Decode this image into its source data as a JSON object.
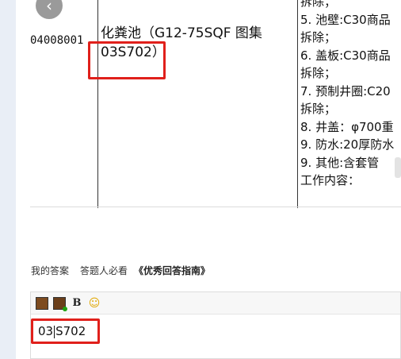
{
  "document": {
    "code": "04008001",
    "name_lines": [
      "化粪池（G12-75SQF 图集",
      "03S702）"
    ],
    "desc_lines": [
      "拆除；",
      "5. 池壁:C30商品",
      "拆除；",
      "6. 盖板:C30商品",
      "拆除；",
      "7. 预制井圈:C20",
      "拆除；",
      "8. 井盖：φ700重",
      "9. 防水:20厚防水",
      "9. 其他:含套管",
      "工作内容："
    ]
  },
  "nav": {
    "back_icon": "‹"
  },
  "answer": {
    "tab_my_answer": "我的答案",
    "tab_must_read": "答题人必看",
    "guide_link": "《优秀回答指南》"
  },
  "editor": {
    "toolbar": {
      "bold_label": "B",
      "emoji_glyph": "☺"
    },
    "content_before_caret": "03",
    "content_after_caret": "S702"
  },
  "colors": {
    "highlight": "#e0201b",
    "rail": "#e9eef6"
  }
}
